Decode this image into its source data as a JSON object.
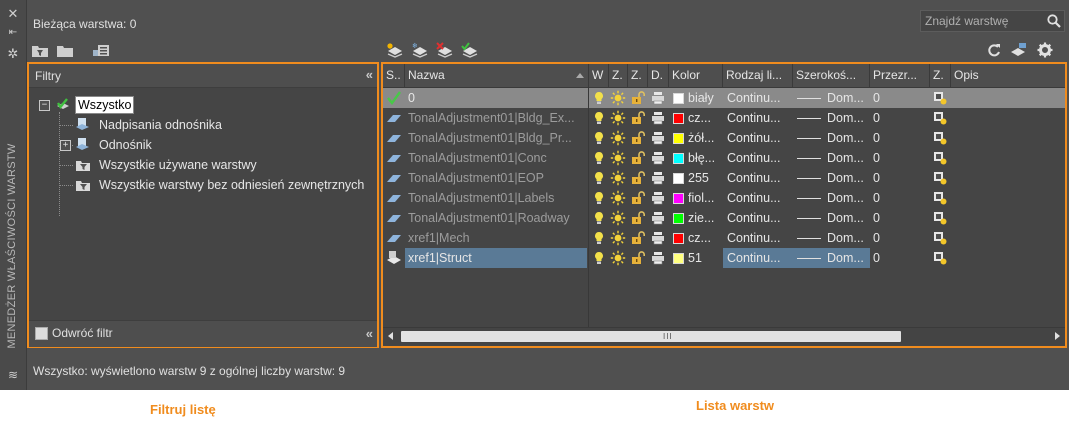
{
  "palette_title": "MENEDŻER WŁAŚCIWOŚCI WARSTW",
  "header": {
    "current_layer": "Bieżąca warstwa: 0",
    "search_placeholder": "Znajdź warstwę"
  },
  "filter_panel": {
    "title": "Filtry",
    "tree": [
      {
        "label": "Wszystko",
        "level": 0,
        "expander": "−",
        "selected": true
      },
      {
        "label": "Nadpisania odnośnika",
        "level": 1
      },
      {
        "label": "Odnośnik",
        "level": 1,
        "expander": "+"
      },
      {
        "label": "Wszystkie używane warstwy",
        "level": 1
      },
      {
        "label": "Wszystkie warstwy bez odniesień zewnętrznych",
        "level": 1
      }
    ],
    "invert_label": "Odwróć filtr",
    "invert_checked": false
  },
  "layer_list": {
    "columns": [
      "S..",
      "Nazwa",
      "W",
      "Z.",
      "Z.",
      "D.",
      "Kolor",
      "Rodzaj li...",
      "Szerokoś...",
      "Przezr...",
      "Z.",
      "Opis"
    ],
    "rows": [
      {
        "name": "0",
        "status": "current",
        "color_hex": "#ffffff",
        "color_name": "biały",
        "linetype": "Continu...",
        "lineweight": "Dom...",
        "transparency": "0",
        "xref": false,
        "selected": false
      },
      {
        "name": "TonalAdjustment01|Bldg_Ex...",
        "status": "layer",
        "color_hex": "#ff0000",
        "color_name": "cz...",
        "linetype": "Continu...",
        "lineweight": "Dom...",
        "transparency": "0",
        "xref": true,
        "selected": false
      },
      {
        "name": "TonalAdjustment01|Bldg_Pr...",
        "status": "layer",
        "color_hex": "#ffff00",
        "color_name": "żół...",
        "linetype": "Continu...",
        "lineweight": "Dom...",
        "transparency": "0",
        "xref": true,
        "selected": false
      },
      {
        "name": "TonalAdjustment01|Conc",
        "status": "layer",
        "color_hex": "#00ffff",
        "color_name": "błę...",
        "linetype": "Continu...",
        "lineweight": "Dom...",
        "transparency": "0",
        "xref": true,
        "selected": false
      },
      {
        "name": "TonalAdjustment01|EOP",
        "status": "layer",
        "color_hex": "#ffffff",
        "color_name": "255",
        "linetype": "Continu...",
        "lineweight": "Dom...",
        "transparency": "0",
        "xref": true,
        "selected": false
      },
      {
        "name": "TonalAdjustment01|Labels",
        "status": "layer",
        "color_hex": "#ff00ff",
        "color_name": "fiol...",
        "linetype": "Continu...",
        "lineweight": "Dom...",
        "transparency": "0",
        "xref": true,
        "selected": false
      },
      {
        "name": "TonalAdjustment01|Roadway",
        "status": "layer",
        "color_hex": "#00ff00",
        "color_name": "zie...",
        "linetype": "Continu...",
        "lineweight": "Dom...",
        "transparency": "0",
        "xref": true,
        "selected": false
      },
      {
        "name": "xref1|Mech",
        "status": "layer",
        "color_hex": "#ff0000",
        "color_name": "cz...",
        "linetype": "Continu...",
        "lineweight": "Dom...",
        "transparency": "0",
        "xref": true,
        "selected": false
      },
      {
        "name": "xref1|Struct",
        "status": "selected",
        "color_hex": "#ffff80",
        "color_name": "51",
        "linetype": "Continu...",
        "lineweight": "Dom...",
        "transparency": "0",
        "xref": true,
        "selected": true
      }
    ]
  },
  "status_bar": "Wszystko: wyświetlono warstw 9 z ogólnej liczby warstw: 9",
  "captions": {
    "filter": "Filtruj listę",
    "layers": "Lista warstw"
  },
  "accent_color": "#f08c1e",
  "selection_color": "#5a7a96"
}
